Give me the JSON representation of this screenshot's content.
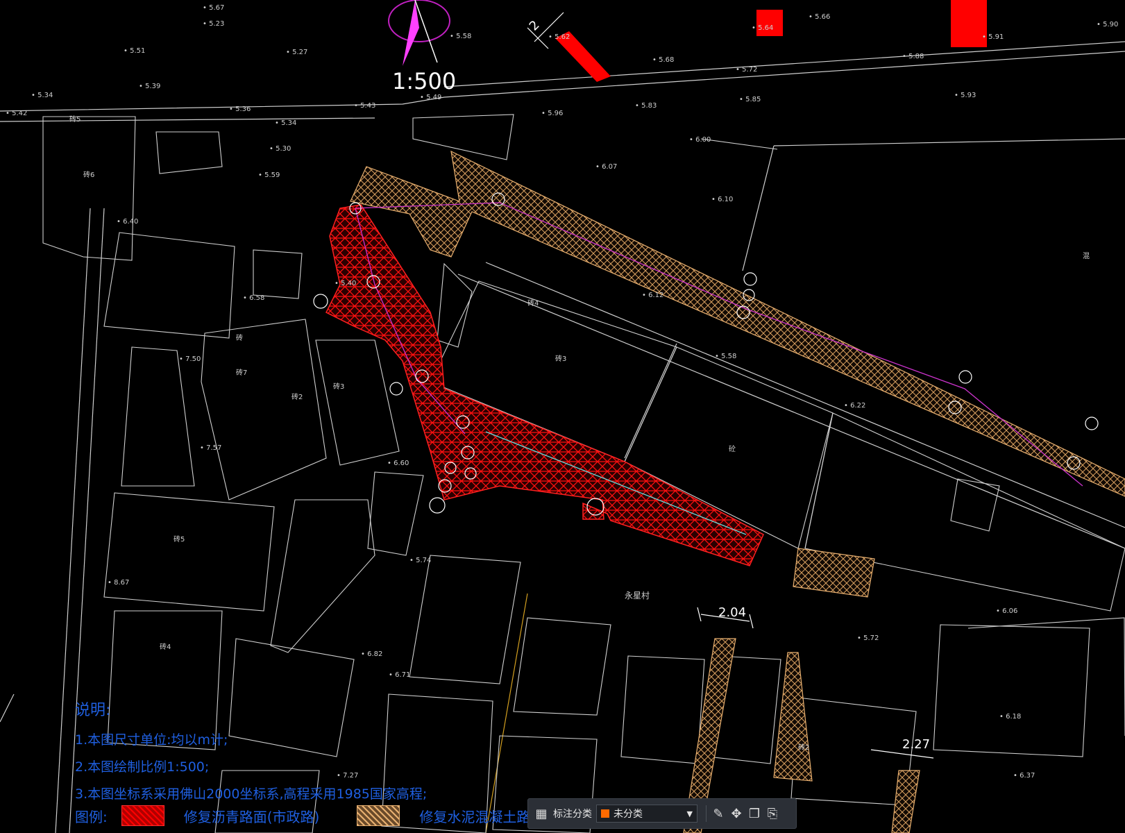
{
  "drawing": {
    "scale_label": "1:500",
    "village_label": "永星村",
    "dim_top": "2",
    "dim_a": "2.04",
    "dim_b": "2.27",
    "elevations": [
      "5.67",
      "5.23",
      "5.51",
      "5.27",
      "5.58",
      "5.62",
      "5.66",
      "5.64",
      "5.91",
      "5.90",
      "5.34",
      "5.39",
      "5.36",
      "5.42",
      "5.43",
      "5.49",
      "5.96",
      "5.68",
      "5.72",
      "5.83",
      "5.85",
      "5.93",
      "5.88",
      "5.34",
      "5.30",
      "5.59",
      "6.00",
      "6.07",
      "6.10",
      "6.40",
      "6.58",
      "6.12",
      "5.40",
      "7.50",
      "7.57",
      "6.60",
      "5.58",
      "6.22",
      "5.74",
      "8.67",
      "6.82",
      "6.71",
      "7.27",
      "6.06",
      "5.72",
      "6.18",
      "6.37"
    ],
    "building_labels": [
      "砖5",
      "砖6",
      "砖4",
      "砖7",
      "砖3",
      "砖2",
      "砼",
      "混",
      "砖",
      "砖5",
      "砖4",
      "砖3",
      "砖2"
    ]
  },
  "notes": {
    "title": "说明:",
    "line1": "1.本图尺寸单位:均以m计;",
    "line2": "2.本图绘制比例1:500;",
    "line3": "3.本图坐标系采用佛山2000坐标系,高程采用1985国家高程;"
  },
  "legend": {
    "label": "图例:",
    "item1": "修复沥青路面(市政路)",
    "item2": "修复水泥混凝土路面"
  },
  "toolbar": {
    "label": "标注分类",
    "selected": "未分类",
    "accent": "#ff6a00"
  },
  "colors": {
    "background": "#000000",
    "linework": "#d8d8d8",
    "asphalt_red": "#ff0000",
    "concrete_tan": "#e8b070",
    "pipe_magenta": "#cc33cc",
    "pipe_cyan": "#66dddd",
    "note_blue": "#1f5fe0"
  }
}
